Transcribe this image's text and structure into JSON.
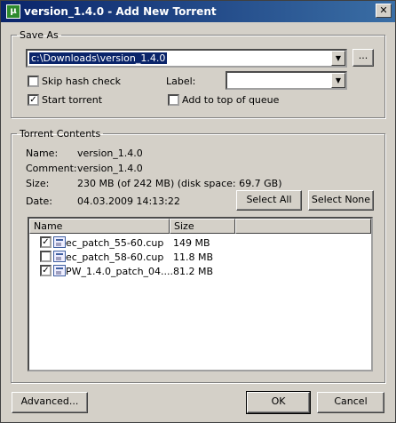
{
  "window": {
    "title": "version_1.4.0 - Add New Torrent",
    "app_icon_letter": "µ"
  },
  "save_as": {
    "legend": "Save As",
    "path": "c:\\Downloads\\version_1.4.0",
    "browse_label": "...",
    "skip_hash_check": {
      "label": "Skip hash check",
      "checked": false
    },
    "start_torrent": {
      "label": "Start torrent",
      "checked": true
    },
    "label_caption": "Label:",
    "label_value": "",
    "add_to_top": {
      "label": "Add to top of queue",
      "checked": false
    }
  },
  "contents": {
    "legend": "Torrent Contents",
    "name_caption": "Name:",
    "name_value": "version_1.4.0",
    "comment_caption": "Comment:",
    "comment_value": "version_1.4.0",
    "size_caption": "Size:",
    "size_value": "230 MB (of 242 MB) (disk space: 69.7 GB)",
    "date_caption": "Date:",
    "date_value": "04.03.2009 14:13:22",
    "select_all_label": "Select All",
    "select_none_label": "Select None",
    "columns": [
      "Name",
      "Size"
    ],
    "files": [
      {
        "name": "ec_patch_55-60.cup",
        "size": "149 MB",
        "checked": true
      },
      {
        "name": "ec_patch_58-60.cup",
        "size": "11.8 MB",
        "checked": false
      },
      {
        "name": "PW_1.4.0_patch_04....",
        "size": "81.2 MB",
        "checked": true
      }
    ]
  },
  "footer": {
    "advanced_label": "Advanced...",
    "ok_label": "OK",
    "cancel_label": "Cancel"
  }
}
